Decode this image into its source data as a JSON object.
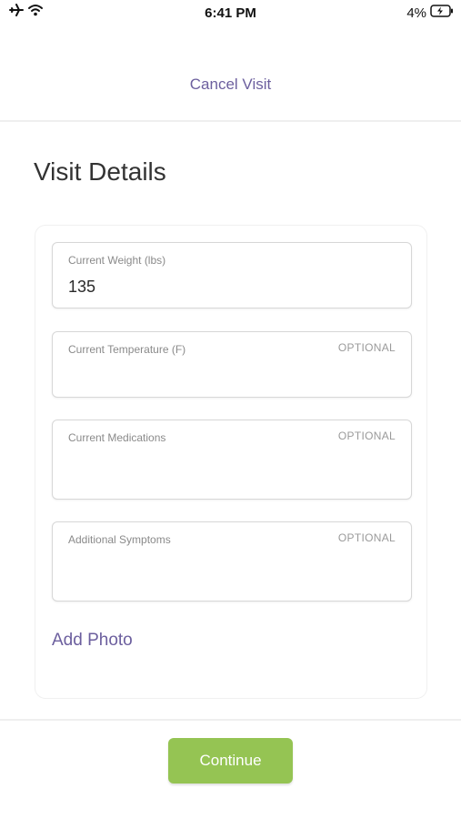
{
  "status_bar": {
    "time": "6:41 PM",
    "battery": "4%",
    "icons": [
      "airplane-icon",
      "wifi-icon",
      "battery-charging-icon"
    ]
  },
  "header": {
    "cancel_label": "Cancel Visit"
  },
  "page": {
    "title": "Visit Details"
  },
  "form": {
    "fields": [
      {
        "label": "Current Weight (lbs)",
        "value": "135",
        "optional": ""
      },
      {
        "label": "Current Temperature (F)",
        "value": "",
        "optional": "OPTIONAL"
      },
      {
        "label": "Current Medications",
        "value": "",
        "optional": "OPTIONAL"
      },
      {
        "label": "Additional Symptoms",
        "value": "",
        "optional": "OPTIONAL"
      }
    ],
    "add_photo_label": "Add Photo"
  },
  "footer": {
    "continue_label": "Continue"
  },
  "colors": {
    "accent": "#6c5f9e",
    "continue": "#95c453"
  }
}
